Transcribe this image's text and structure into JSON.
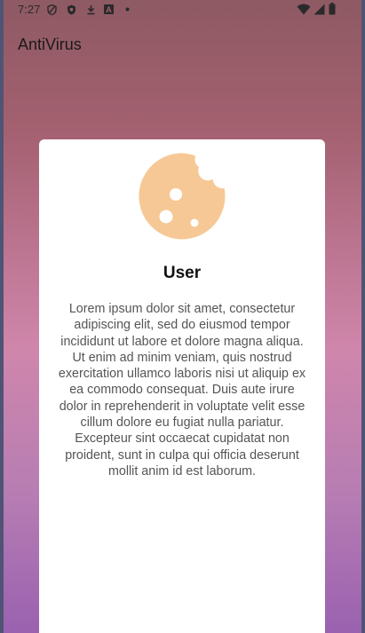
{
  "status_bar": {
    "time": "7:27",
    "left_icons": [
      "shield-icon",
      "shield-outline-icon",
      "download-icon",
      "app-a-icon",
      "dot-icon"
    ],
    "right_icons": [
      "wifi-icon",
      "signal-icon",
      "battery-icon"
    ]
  },
  "app": {
    "title": "AntiVirus"
  },
  "dialog": {
    "icon": "cookie-icon",
    "icon_color": "#f6c896",
    "title": "User",
    "body": "Lorem ipsum dolor sit amet, consectetur adipiscing elit, sed do eiusmod tempor incididunt ut labore et dolore magna aliqua. Ut enim ad minim veniam, quis nostrud exercitation ullamco laboris nisi ut aliquip ex ea commodo consequat. Duis aute irure dolor in reprehenderit in voluptate velit esse cillum dolore eu fugiat nulla pariatur. Excepteur sint occaecat cupidatat non proident, sunt in culpa qui officia deserunt mollit anim id est laborum."
  }
}
